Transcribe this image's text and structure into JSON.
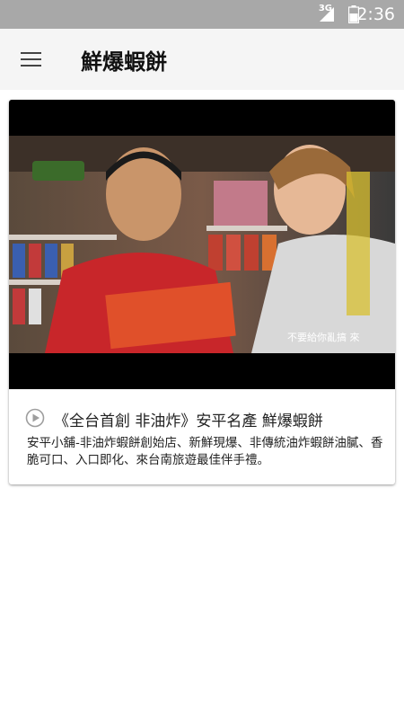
{
  "status_bar": {
    "network": "3G",
    "time": "2:36",
    "icons": [
      "signal-icon",
      "battery-icon"
    ]
  },
  "app_bar": {
    "title": "鮮爆蝦餅",
    "menu_icon": "hamburger-menu-icon"
  },
  "video_card": {
    "thumbnail_caption": "不要給你亂搞 來",
    "play_icon": "play-circle-icon",
    "title": "《全台首創 非油炸》安平名產 鮮爆蝦餅",
    "description": "安平小舖-非油炸蝦餅創始店、新鮮現爆、非傳統油炸蝦餅油膩、香脆可口、入口即化、來台南旅遊最佳伴手禮。"
  },
  "colors": {
    "status_bar": "#a8a8a8",
    "app_bar": "#f5f5f5",
    "thumbnail_bg": "#000000",
    "play_icon": "#9e9e9e"
  }
}
